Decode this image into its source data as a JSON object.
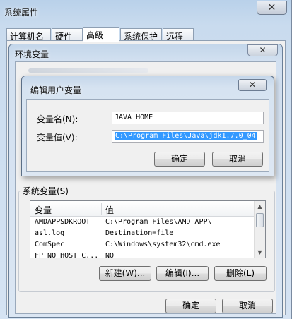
{
  "sysprops": {
    "title": "系统属性",
    "close_glyph": "✕",
    "tabs": [
      "计算机名",
      "硬件",
      "高级",
      "系统保护",
      "远程"
    ],
    "ok_label": "确定",
    "cancel_label": "取消"
  },
  "envvars": {
    "title": "环境变量",
    "close_glyph": "✕",
    "system_group_label": "系统变量(S)",
    "columns": {
      "name": "变量",
      "value": "值"
    },
    "rows": [
      {
        "name": "AMDAPPSDKROOT",
        "value": "C:\\Program Files\\AMD APP\\"
      },
      {
        "name": "asl.log",
        "value": "Destination=file"
      },
      {
        "name": "ComSpec",
        "value": "C:\\Windows\\system32\\cmd.exe"
      },
      {
        "name": "FP_NO_HOST_C...",
        "value": "NO"
      }
    ],
    "new_label": "新建(W)...",
    "edit_label": "编辑(I)...",
    "delete_label": "删除(L)"
  },
  "edit_dialog": {
    "title": "编辑用户变量",
    "close_glyph": "✕",
    "name_label": "变量名(N):",
    "name_value": "JAVA_HOME",
    "value_label": "变量值(V):",
    "value_value": "C:\\Program Files\\Java\\jdk1.7.0_04",
    "ok_label": "确定",
    "cancel_label": "取消"
  }
}
